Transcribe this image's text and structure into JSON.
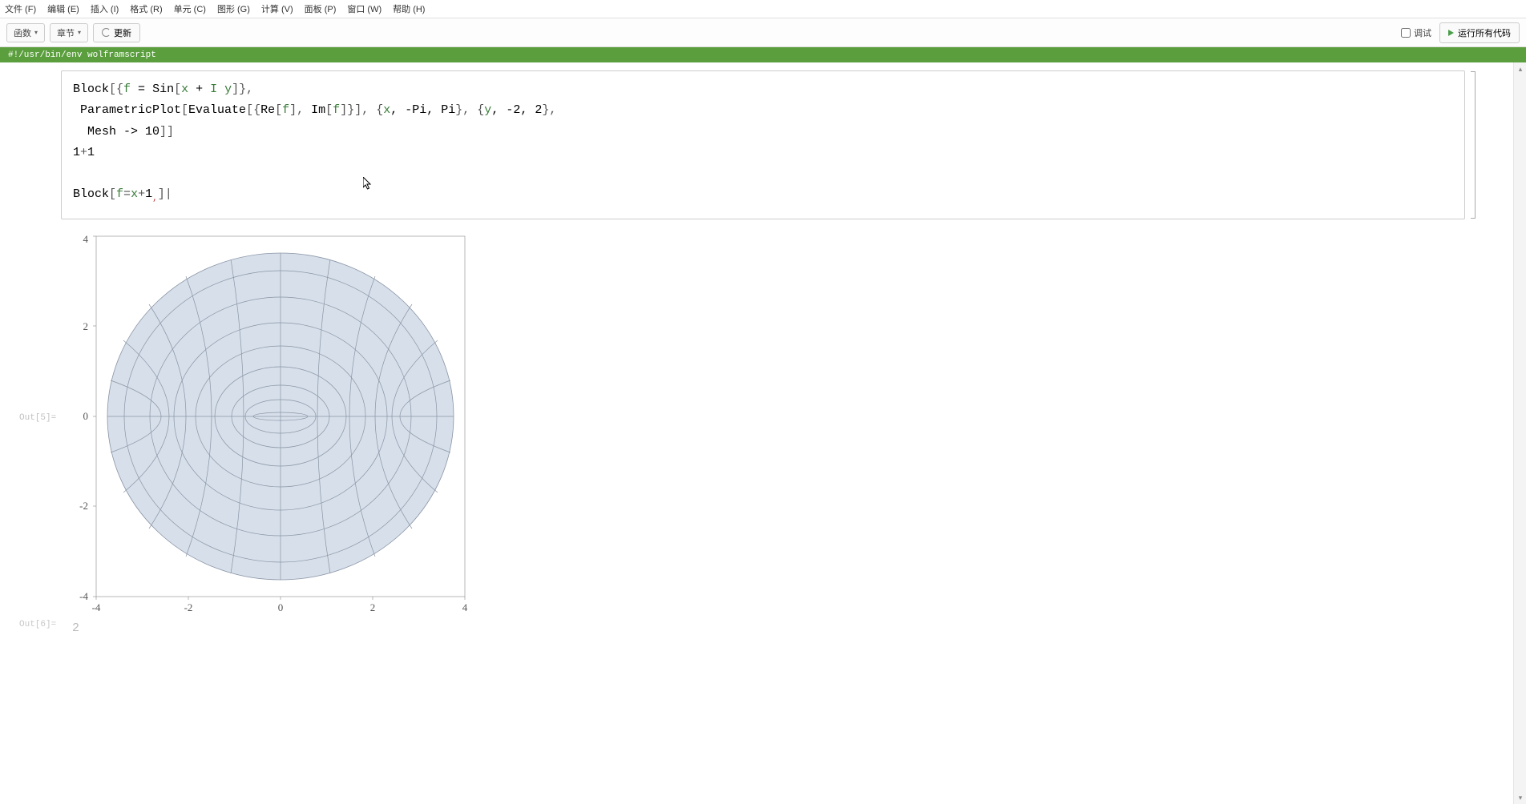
{
  "menubar": {
    "file": "文件 (F)",
    "edit": "编辑 (E)",
    "insert": "插入 (I)",
    "format": "格式 (R)",
    "cell": "单元 (C)",
    "graphics": "图形 (G)",
    "evaluate": "计算 (V)",
    "palettes": "面板 (P)",
    "window": "窗口 (W)",
    "help": "帮助 (H)"
  },
  "toolbar": {
    "functions": "函数",
    "sections": "章节",
    "refresh": "更新",
    "debug": "调试",
    "run_all": "运行所有代码"
  },
  "shebang": "#!/usr/bin/env wolframscript",
  "code": {
    "line1a": "Block",
    "line1b": "[{",
    "line1c": "f",
    "line1d": " = ",
    "line1e": "Sin",
    "line1f": "[",
    "line1g": "x",
    "line1h": " + ",
    "line1i": "I y",
    "line1j": "]},",
    "line2a": " ParametricPlot",
    "line2b": "[",
    "line2c": "Evaluate",
    "line2d": "[{",
    "line2e": "Re",
    "line2f": "[",
    "line2g": "f",
    "line2h": "], ",
    "line2i": "Im",
    "line2j": "[",
    "line2k": "f",
    "line2l": "]}], {",
    "line2m": "x",
    "line2n": ", -",
    "line2o": "Pi",
    "line2p": ", ",
    "line2q": "Pi",
    "line2r": "}, {",
    "line2s": "y",
    "line2t": ", -",
    "line2u": "2",
    "line2v": ", ",
    "line2w": "2",
    "line2x": "},",
    "line3a": "  Mesh",
    "line3b": " -> ",
    "line3c": "10",
    "line3d": "]]",
    "line4a": "1",
    "line4b": "+",
    "line4c": "1",
    "line6a": "Block",
    "line6b": "[",
    "line6c": "f",
    "line6d": "=",
    "line6e": "x",
    "line6f": "+",
    "line6g": "1",
    "line6h": ",",
    "line6i": "]|"
  },
  "output": {
    "label": "Out[5]=",
    "out6_label": "Out[6]=",
    "out6_value": "2"
  },
  "chart_data": {
    "type": "parametric-mesh",
    "title": "",
    "xlabel": "",
    "ylabel": "",
    "xlim": [
      -4,
      4
    ],
    "ylim": [
      -4,
      4
    ],
    "x_ticks": [
      -4,
      -2,
      0,
      2,
      4
    ],
    "y_ticks": [
      -4,
      -2,
      0,
      2,
      4
    ],
    "description": "ParametricPlot of {Re[Sin[x+I y]], Im[Sin[x+I y]]} over x∈[-π,π], y∈[-2,2] with Mesh->10; elliptic radial contours and hyperbolic arcs, fill color light steel blue",
    "mesh_lines": 10,
    "fill_color": "#d6dfea",
    "line_color": "#8a95a5",
    "radial_ellipses": [
      {
        "rx": 0.59,
        "ry": 0.08
      },
      {
        "rx": 0.77,
        "ry": 0.37
      },
      {
        "rx": 1.06,
        "ry": 0.7
      },
      {
        "rx": 1.42,
        "ry": 1.1
      },
      {
        "rx": 1.84,
        "ry": 1.56
      },
      {
        "rx": 2.31,
        "ry": 2.08
      },
      {
        "rx": 2.83,
        "ry": 2.65
      },
      {
        "rx": 3.38,
        "ry": 3.24
      }
    ],
    "boundary_ellipse": {
      "rx": 3.76,
      "ry": 3.63
    }
  }
}
